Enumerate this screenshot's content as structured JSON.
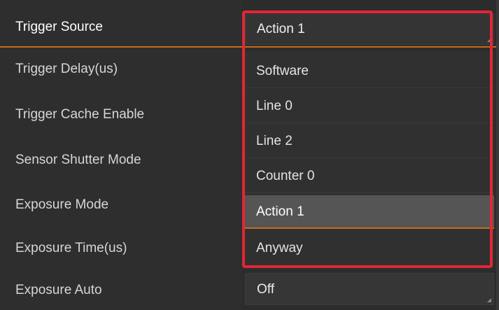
{
  "properties": {
    "trigger_source": "Trigger Source",
    "trigger_delay": "Trigger Delay(us)",
    "trigger_cache_enable": "Trigger Cache Enable",
    "sensor_shutter_mode": "Sensor Shutter Mode",
    "exposure_mode": "Exposure Mode",
    "exposure_time": "Exposure Time(us)",
    "exposure_auto": "Exposure Auto"
  },
  "trigger_source_select": {
    "value": "Action 1",
    "options": [
      "Software",
      "Line 0",
      "Line 2",
      "Counter 0",
      "Action 1",
      "Anyway"
    ],
    "selected_index": 4
  },
  "exposure_auto_select": {
    "value": "Off"
  },
  "colors": {
    "background": "#2e2e2e",
    "accent_orange": "#c86a1a",
    "highlight_red": "#e32636",
    "selected_bg": "#555555"
  }
}
